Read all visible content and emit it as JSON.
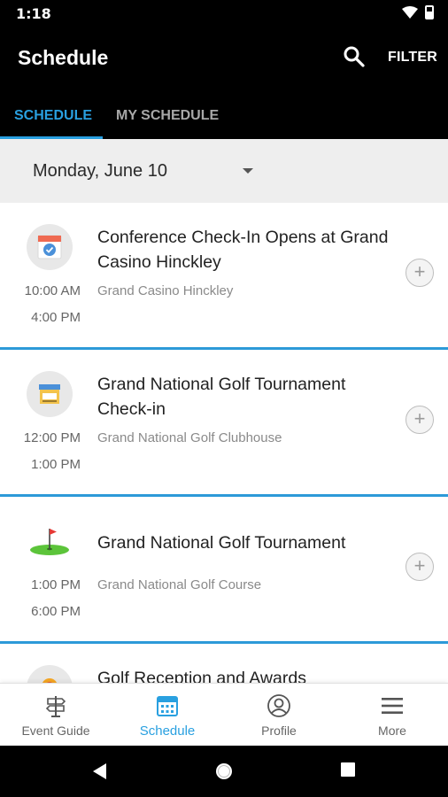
{
  "status_bar": {
    "time": "1:18"
  },
  "app_bar": {
    "title": "Schedule",
    "filter_label": "FILTER"
  },
  "tabs": [
    {
      "label": "SCHEDULE",
      "active": true
    },
    {
      "label": "MY SCHEDULE",
      "active": false
    }
  ],
  "date_picker": {
    "selected": "Monday, June 10"
  },
  "sessions": [
    {
      "title": "Conference Check-In Opens at Grand Casino Hinckley",
      "venue": "Grand Casino Hinckley",
      "start": "10:00 AM",
      "end": "4:00 PM",
      "icon": "calendar-check-icon"
    },
    {
      "title": "Grand National Golf Tournament Check-in",
      "venue": "Grand National Golf Clubhouse",
      "start": "12:00 PM",
      "end": "1:00 PM",
      "icon": "booth-icon"
    },
    {
      "title": "Grand National Golf Tournament",
      "venue": "Grand National Golf Course",
      "start": "1:00 PM",
      "end": "6:00 PM",
      "icon": "golf-flag-icon"
    },
    {
      "title": "Golf Reception and Awards",
      "venue": "",
      "start": "",
      "end": "",
      "icon": "award-icon"
    }
  ],
  "bottom_nav": [
    {
      "label": "Event Guide",
      "icon": "signpost-icon",
      "active": false
    },
    {
      "label": "Schedule",
      "icon": "calendar-icon",
      "active": true
    },
    {
      "label": "Profile",
      "icon": "profile-icon",
      "active": false
    },
    {
      "label": "More",
      "icon": "menu-icon",
      "active": false
    }
  ],
  "colors": {
    "accent": "#29a0e0",
    "divider": "#2d9ad8",
    "app_bar": "#000000"
  }
}
